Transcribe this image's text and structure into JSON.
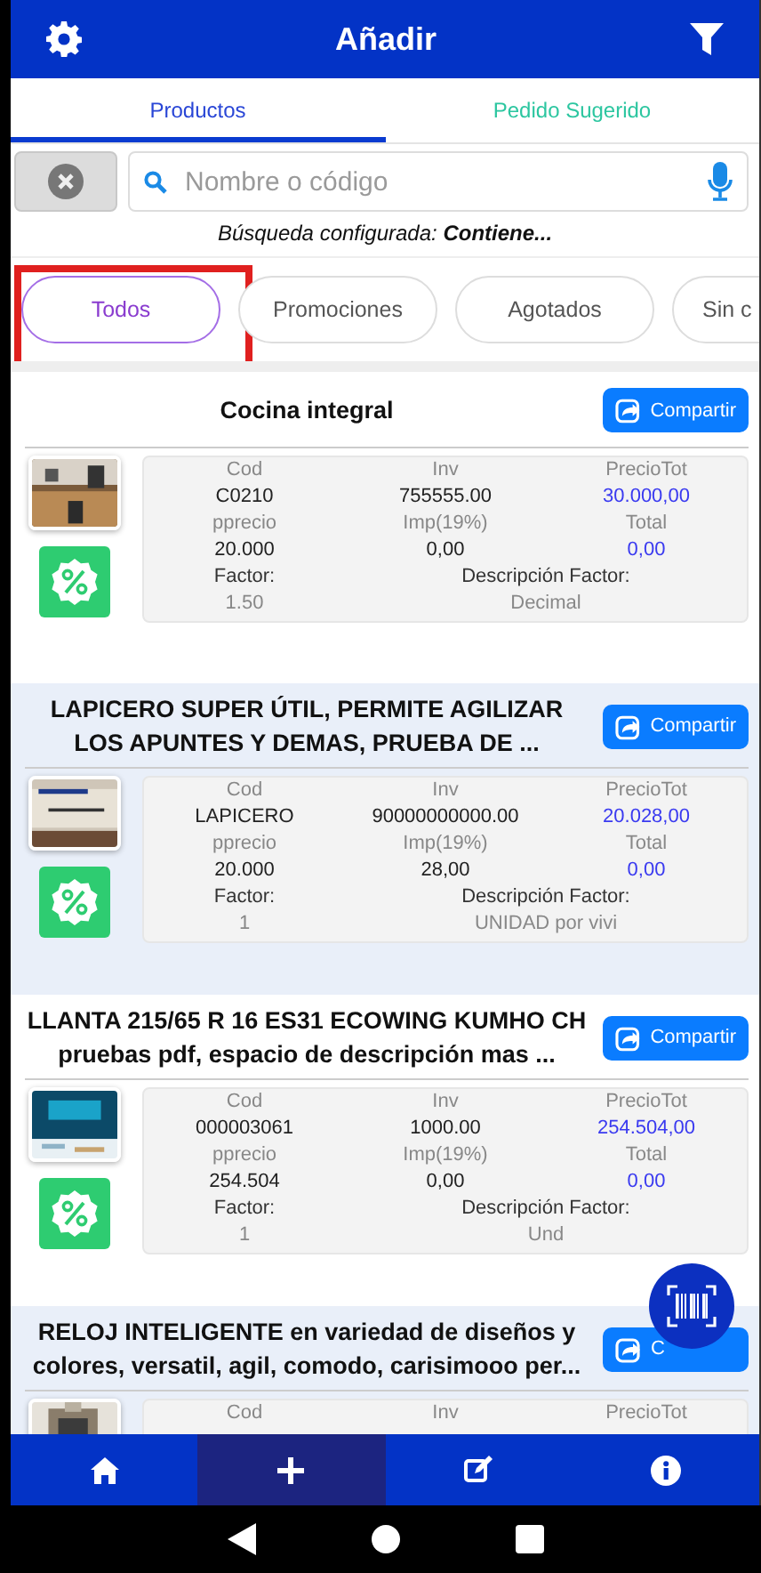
{
  "header": {
    "title": "Añadir"
  },
  "tabs": [
    {
      "label": "Productos",
      "selected": true
    },
    {
      "label": "Pedido Sugerido",
      "selected": false
    }
  ],
  "search": {
    "placeholder": "Nombre o código",
    "hint": "Búsqueda configurada: **Contiene...**"
  },
  "chips": [
    {
      "label": "Todos",
      "selected": true,
      "highlighted": true
    },
    {
      "label": "Promociones",
      "selected": false,
      "highlighted": false
    },
    {
      "label": "Agotados",
      "selected": false,
      "highlighted": false
    },
    {
      "label": "Sin c",
      "selected": false,
      "highlighted": false
    }
  ],
  "products": [
    {
      "title": "Cocina integral",
      "share": "Compartir",
      "promo": true,
      "rows": [
        [
          {
            "text": "Cod",
            "kind": "label"
          },
          {
            "text": "Inv",
            "kind": "label"
          },
          {
            "text": "PrecioTot",
            "kind": "label"
          }
        ],
        [
          {
            "text": "C0210",
            "kind": "value"
          },
          {
            "text": "755555.00",
            "kind": "value"
          },
          {
            "text": "30.000,00",
            "kind": "price"
          }
        ],
        [
          {
            "text": "pprecio",
            "kind": "label"
          },
          {
            "text": "Imp(19%)",
            "kind": "label"
          },
          {
            "text": "Total",
            "kind": "label"
          }
        ],
        [
          {
            "text": "20.000",
            "kind": "value"
          },
          {
            "text": "0,00",
            "kind": "value"
          },
          {
            "text": "0,00",
            "kind": "price"
          }
        ],
        [
          {
            "text": "Factor:",
            "kind": "head"
          },
          {
            "text": "Descripción Factor:",
            "kind": "head"
          }
        ],
        [
          {
            "text": "1.50",
            "kind": "label"
          },
          {
            "text": "Decimal",
            "kind": "label"
          }
        ]
      ]
    },
    {
      "title": "LAPICERO SUPER ÚTIL, PERMITE AGILIZAR LOS APUNTES Y DEMAS, PRUEBA DE ...",
      "share": "Compartir",
      "promo": true,
      "rows": [
        [
          {
            "text": "Cod",
            "kind": "label"
          },
          {
            "text": "Inv",
            "kind": "label"
          },
          {
            "text": "PrecioTot",
            "kind": "label"
          }
        ],
        [
          {
            "text": "LAPICERO",
            "kind": "value"
          },
          {
            "text": "90000000000.00",
            "kind": "value"
          },
          {
            "text": "20.028,00",
            "kind": "price"
          }
        ],
        [
          {
            "text": "pprecio",
            "kind": "label"
          },
          {
            "text": "Imp(19%)",
            "kind": "label"
          },
          {
            "text": "Total",
            "kind": "label"
          }
        ],
        [
          {
            "text": "20.000",
            "kind": "value"
          },
          {
            "text": "28,00",
            "kind": "value"
          },
          {
            "text": "0,00",
            "kind": "price"
          }
        ],
        [
          {
            "text": "Factor:",
            "kind": "head"
          },
          {
            "text": "Descripción Factor:",
            "kind": "head"
          }
        ],
        [
          {
            "text": "1",
            "kind": "label"
          },
          {
            "text": "UNIDAD por vivi",
            "kind": "label"
          }
        ]
      ]
    },
    {
      "title": "LLANTA 215/65 R 16 ES31 ECOWING KUMHO CH pruebas pdf, espacio de descripción mas ...",
      "share": "Compartir",
      "promo": true,
      "rows": [
        [
          {
            "text": "Cod",
            "kind": "label"
          },
          {
            "text": "Inv",
            "kind": "label"
          },
          {
            "text": "PrecioTot",
            "kind": "label"
          }
        ],
        [
          {
            "text": "000003061",
            "kind": "value"
          },
          {
            "text": "1000.00",
            "kind": "value"
          },
          {
            "text": "254.504,00",
            "kind": "price"
          }
        ],
        [
          {
            "text": "pprecio",
            "kind": "label"
          },
          {
            "text": "Imp(19%)",
            "kind": "label"
          },
          {
            "text": "Total",
            "kind": "label"
          }
        ],
        [
          {
            "text": "254.504",
            "kind": "value"
          },
          {
            "text": "0,00",
            "kind": "value"
          },
          {
            "text": "0,00",
            "kind": "price"
          }
        ],
        [
          {
            "text": "Factor:",
            "kind": "head"
          },
          {
            "text": "Descripción Factor:",
            "kind": "head"
          }
        ],
        [
          {
            "text": "1",
            "kind": "label"
          },
          {
            "text": "Und",
            "kind": "label"
          }
        ]
      ]
    },
    {
      "title": "RELOJ INTELIGENTE en variedad de diseños y colores, versatil, agil, comodo, carisimooo per...",
      "share": "C",
      "promo": false,
      "rows": [
        [
          {
            "text": "Cod",
            "kind": "label"
          },
          {
            "text": "Inv",
            "kind": "label"
          },
          {
            "text": "PrecioTot",
            "kind": "label"
          }
        ]
      ]
    }
  ],
  "nav": [
    {
      "selected": false
    },
    {
      "selected": true
    },
    {
      "selected": false
    },
    {
      "selected": false
    }
  ]
}
